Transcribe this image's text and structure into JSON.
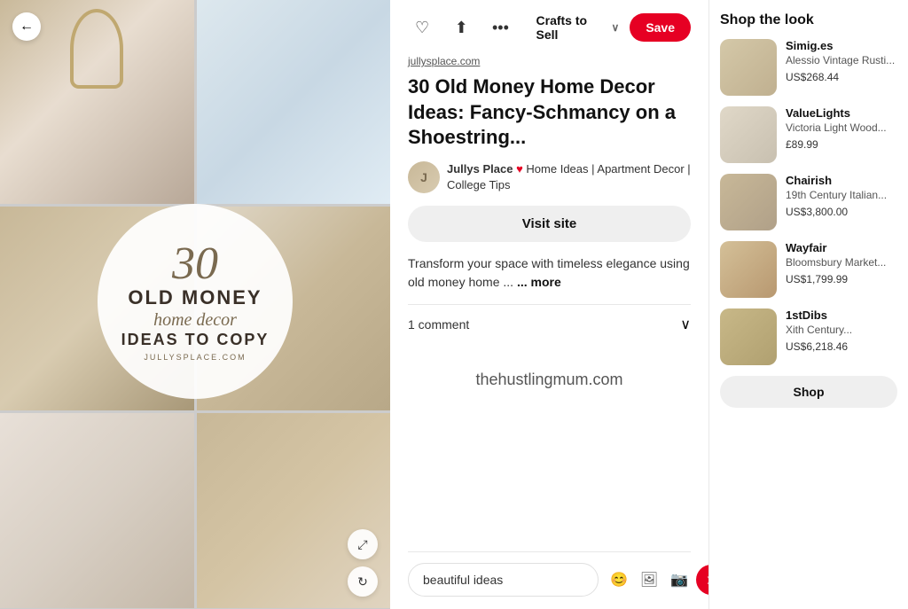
{
  "back_button": "←",
  "toolbar": {
    "like_icon": "♡",
    "share_icon": "⬆",
    "more_icon": "•••",
    "board_name": "Crafts to Sell",
    "save_label": "Save"
  },
  "pin": {
    "source_url": "jullysplace.com",
    "title": "30 Old Money Home Decor Ideas: Fancy-Schmancy on a Shoestring...",
    "author_name": "Jullys Place",
    "author_boards": "Home Ideas | Apartment Decor | College Tips",
    "visit_site_label": "Visit site",
    "description": "Transform your space with timeless elegance using old money home ...",
    "more_label": "... more",
    "comments_label": "1 comment",
    "website_attribution": "thehustlingmum.com",
    "comment_placeholder": "beautiful ideas"
  },
  "image_overlay": {
    "number": "30",
    "line1": "OLD MONEY",
    "line2": "home decor",
    "line3": "IDEAS TO COPY",
    "website": "JULLYSPLACE.COM"
  },
  "shop": {
    "title": "Shop the look",
    "items": [
      {
        "store": "Simig.es",
        "product": "Alessio Vintage Rusti...",
        "price": "US$268.44"
      },
      {
        "store": "ValueLights",
        "product": "Victoria Light Wood...",
        "price": "£89.99"
      },
      {
        "store": "Chairish",
        "product": "19th Century Italian...",
        "price": "US$3,800.00"
      },
      {
        "store": "Wayfair",
        "product": "Bloomsbury Market...",
        "price": "US$1,799.99"
      },
      {
        "store": "1stDibs",
        "product": "Xith Century...",
        "price": "US$6,218.46"
      }
    ],
    "shop_button_label": "Shop"
  },
  "icons": {
    "back": "←",
    "expand": "⤢",
    "rotate": "↻",
    "chevron_down": "∨",
    "emoji": "😊",
    "image": "🖼",
    "camera": "📷",
    "send": "➤"
  }
}
